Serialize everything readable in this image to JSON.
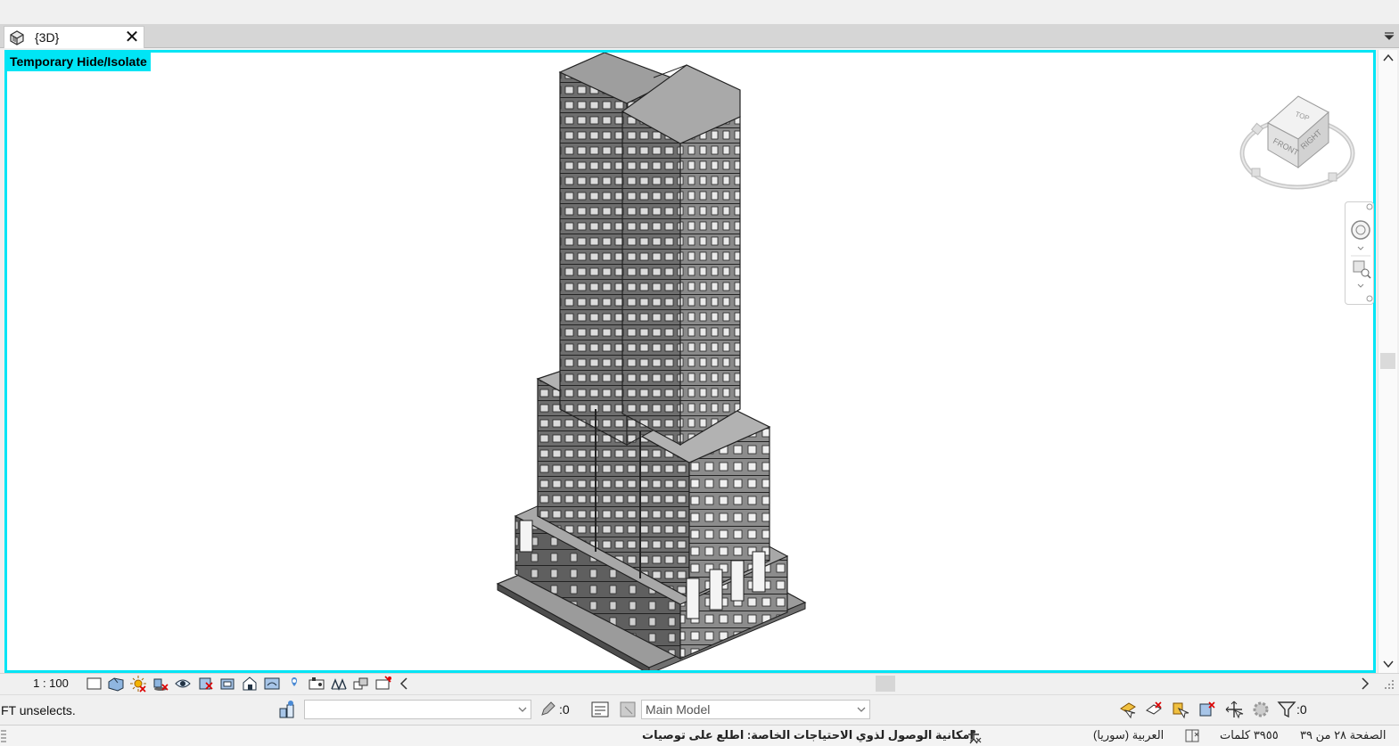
{
  "tab": {
    "label": "{3D}"
  },
  "viewport": {
    "banner": "Temporary Hide/Isolate",
    "border_color": "#00e5f5"
  },
  "viewcube": {
    "top": "TOP",
    "front": "FRONT",
    "right": "RIGHT"
  },
  "view_control_bar": {
    "scale": "1 : 100",
    "icons": [
      "detail-level-icon",
      "visual-style-icon",
      "sun-path-icon",
      "shadows-icon",
      "render-icon",
      "crop-view-icon",
      "show-crop-icon",
      "unlock-3d-view-icon",
      "temporary-hide-icon",
      "reveal-hidden-icon",
      "worksharing-display-icon",
      "analytical-model-icon",
      "highlight-displacement-icon",
      "reveal-constraints-icon"
    ]
  },
  "status_bar": {
    "message": "FT unselects.",
    "workset_value": "",
    "editable_count": ":0",
    "design_option": "Main Model",
    "filter_count": ":0"
  },
  "word_status": {
    "page": "الصفحة ٢٨ من ٣٩",
    "words": "٣٩٥٥ كلمات",
    "language": "العربية (سوريا)",
    "accessibility": "إمكانية الوصول لذوي الاحتياجات الخاصة: اطلع على توصيات"
  }
}
